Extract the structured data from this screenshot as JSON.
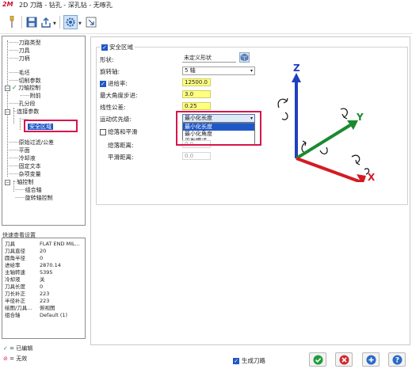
{
  "window": {
    "logo": "2M",
    "title": "2D 刀路 - 钻孔 - 深孔钻 - 无啄孔"
  },
  "toolbar": {
    "icons": [
      "pin-icon",
      "save-icon",
      "export-icon",
      "settings-icon",
      "window-select-icon"
    ]
  },
  "tree": {
    "items": [
      {
        "label": "刀路类型"
      },
      {
        "label": "刀具"
      },
      {
        "label": "刀柄"
      },
      {
        "label": "毛坯"
      },
      {
        "label": "切削参数"
      },
      {
        "label": "刀轴控制"
      },
      {
        "label": "附前"
      },
      {
        "label": "孔分段"
      },
      {
        "label": "连接参数"
      },
      {
        "label": "安全区域"
      },
      {
        "label": "原始过滤/公差"
      },
      {
        "label": "平面"
      },
      {
        "label": "冷却液"
      },
      {
        "label": "固定文本"
      },
      {
        "label": "杂项变量"
      },
      {
        "label": "轴控制"
      },
      {
        "label": "组合轴"
      },
      {
        "label": "旋转轴控制"
      }
    ]
  },
  "quick_view": {
    "title": "快速查看设置",
    "rows": [
      {
        "key": "刀具",
        "value": "FLAT END MIL..."
      },
      {
        "key": "刀具直径",
        "value": "20"
      },
      {
        "key": "圆角半径",
        "value": "0"
      },
      {
        "key": "进给率",
        "value": "2870.14"
      },
      {
        "key": "主轴转速",
        "value": "5395"
      },
      {
        "key": "冷却液",
        "value": "关"
      },
      {
        "key": "刀具长度",
        "value": "0"
      },
      {
        "key": "刀长补正",
        "value": "223"
      },
      {
        "key": "半径补正",
        "value": "223"
      },
      {
        "key": "绘图/刀具...",
        "value": "俯视图"
      },
      {
        "key": "组合轴",
        "value": "Default (1)"
      }
    ]
  },
  "legend": {
    "edited": "= 已编辑",
    "disabled": "= 无效"
  },
  "safety": {
    "group_label": "安全区域",
    "shape_label": "形状:",
    "shape_value": "未定义形状",
    "rotation_axis_label": "旋转轴:",
    "rotation_axis_value": "5 轴",
    "feed_label": "进给率:",
    "feed_value": "12500.0",
    "max_angle_label": "最大角度步进:",
    "max_angle_value": "3.0",
    "linear_tol_label": "线性公差:",
    "linear_tol_value": "0.25",
    "motion_priority_label": "运动优先级:",
    "motion_priority_value": "最小化长度",
    "motion_priority_options": [
      "最小化长度",
      "最小化角度",
      "平衡模式"
    ],
    "smooth_label": "熄落和平滑",
    "smooth_dist_label": "熄落距离:",
    "smooth_dist_value": "0.0",
    "smooth_dist2_label": "平滑距离:",
    "smooth_dist2_value": "0.0"
  },
  "axes": {
    "z": "Z",
    "y": "Y",
    "x": "X"
  },
  "bottom": {
    "generate_label": "生成刀路"
  },
  "colors": {
    "highlight": "#d6154d",
    "selection": "#1f57c7",
    "axis_z": "#1f3fbf",
    "axis_y": "#1a8a2e",
    "axis_x": "#d41b24"
  }
}
